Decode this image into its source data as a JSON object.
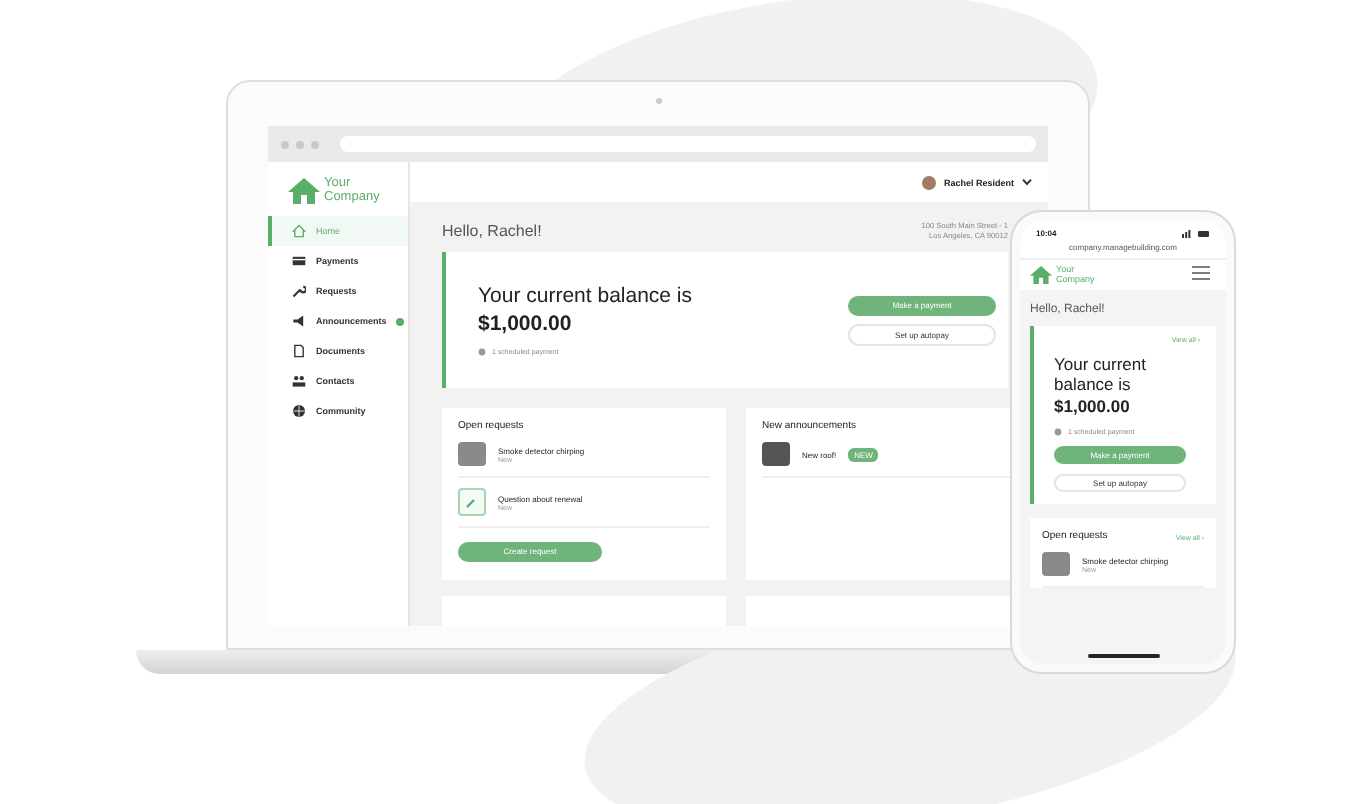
{
  "laptop": {
    "sidebar": {
      "logo": {
        "line1": "Your",
        "line2": "Company"
      },
      "items": [
        {
          "label": "Home",
          "selected": true,
          "notification": false
        },
        {
          "label": "Payments",
          "selected": false,
          "notification": false
        },
        {
          "label": "Requests",
          "selected": false,
          "notification": false
        },
        {
          "label": "Announcements",
          "selected": false,
          "notification": true
        },
        {
          "label": "Documents",
          "selected": false,
          "notification": false
        },
        {
          "label": "Contacts",
          "selected": false,
          "notification": false
        },
        {
          "label": "Community",
          "selected": false,
          "notification": false
        }
      ]
    },
    "header": {
      "user": "Rachel Resident"
    },
    "greeting": "Hello, Rachel!",
    "address": [
      "100 South Main Street - 1",
      "Los Angeles, CA 90012"
    ],
    "balance": {
      "title": "Your current balance is",
      "amount": "$1,000.00",
      "note": "1 scheduled payment",
      "primary_button": "Make a payment",
      "secondary_button": "Set up autopay"
    },
    "open_requests": {
      "title": "Open requests",
      "items": [
        {
          "title": "Smoke detector chirping",
          "status": "New",
          "kind": "photo"
        },
        {
          "title": "Question about renewal",
          "status": "New",
          "kind": "icon"
        }
      ],
      "button": "Create request"
    },
    "announcements": {
      "title": "New announcements",
      "items": [
        {
          "title": "New roof!",
          "badge": "NEW"
        }
      ]
    }
  },
  "phone": {
    "time": "10:04",
    "url": "company.managebuilding.com",
    "logo": {
      "line1": "Your",
      "line2": "Company"
    },
    "greeting": "Hello, Rachel!",
    "view_all": "View all ›",
    "balance": {
      "title": "Your current balance is",
      "amount": "$1,000.00",
      "note": "1 scheduled payment",
      "primary_button": "Make a payment",
      "secondary_button": "Set up autopay"
    },
    "open_requests": {
      "title": "Open requests",
      "view_all": "View all ›",
      "items": [
        {
          "title": "Smoke detector chirping",
          "status": "New"
        }
      ]
    }
  }
}
